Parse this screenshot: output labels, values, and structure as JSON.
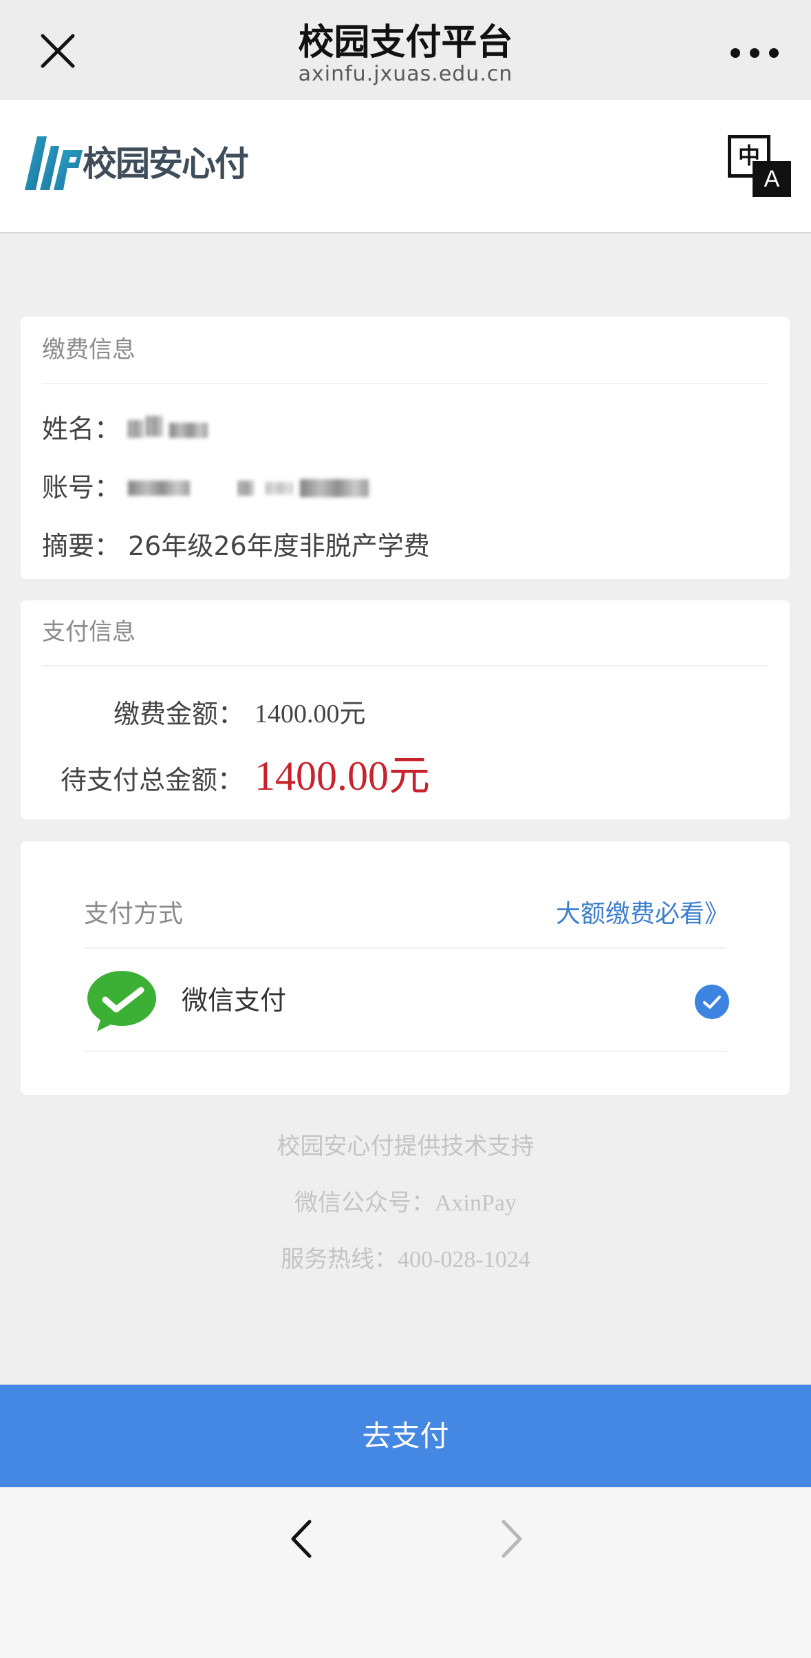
{
  "navbar": {
    "title": "校园支付平台",
    "url": "axinfu.jxuas.edu.cn",
    "close_icon": "close-icon",
    "more_icon": "more-icon"
  },
  "header": {
    "logo_text": "校园安心付",
    "lang_zh": "中",
    "lang_a": "A"
  },
  "payment_info": {
    "title": "缴费信息",
    "name_label": "姓名：",
    "account_label": "账号：",
    "summary_label": "摘要：",
    "summary_value": "26年级26年度非脱产学费"
  },
  "pay_info": {
    "title": "支付信息",
    "fee_label": "缴费金额：",
    "fee_value": "1400.00元",
    "total_label": "待支付总金额：",
    "total_value": "1400.00元"
  },
  "pay_method": {
    "title": "支付方式",
    "large_link": "大额缴费必看》",
    "wechat_label": "微信支付"
  },
  "footer": {
    "support": "校园安心付提供技术支持",
    "wechat_account": "微信公众号：AxinPay",
    "hotline": "服务热线：400-028-1024"
  },
  "actions": {
    "pay_button": "去支付"
  },
  "colors": {
    "accent": "#4488e4",
    "amount_red": "#c8232c",
    "link_blue": "#3d7fce",
    "wechat_green": "#3cb034"
  }
}
